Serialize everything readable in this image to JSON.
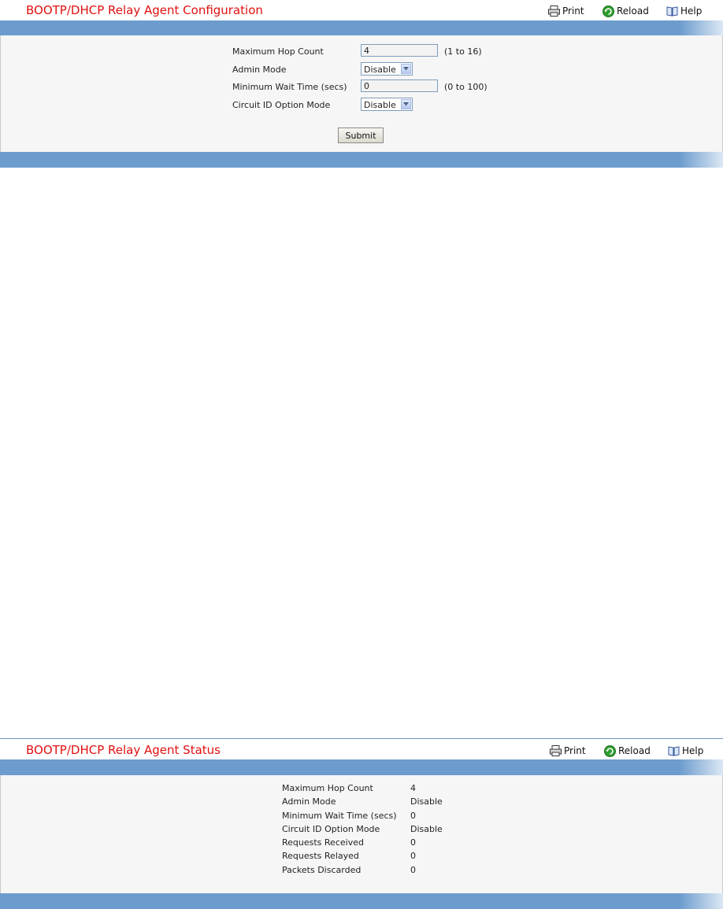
{
  "config": {
    "title": "BOOTP/DHCP Relay Agent Configuration",
    "actions": {
      "print": "Print",
      "reload": "Reload",
      "help": "Help"
    },
    "max_hop": {
      "label": "Maximum Hop Count",
      "value": "4",
      "range": "(1 to 16)"
    },
    "admin_mode": {
      "label": "Admin Mode",
      "value": "Disable"
    },
    "min_wait": {
      "label": "Minimum Wait Time (secs)",
      "value": "0",
      "range": "(0 to 100)"
    },
    "circuit_id": {
      "label": "Circuit ID Option Mode",
      "value": "Disable"
    },
    "submit_label": "Submit"
  },
  "status": {
    "title": "BOOTP/DHCP Relay Agent Status",
    "actions": {
      "print": "Print",
      "reload": "Reload",
      "help": "Help"
    },
    "rows": [
      {
        "label": "Maximum Hop Count",
        "value": "4"
      },
      {
        "label": "Admin Mode",
        "value": "Disable"
      },
      {
        "label": "Minimum Wait Time (secs)",
        "value": "0"
      },
      {
        "label": "Circuit ID Option Mode",
        "value": "Disable"
      },
      {
        "label": "Requests Received",
        "value": "0"
      },
      {
        "label": "Requests Relayed",
        "value": "0"
      },
      {
        "label": "Packets Discarded",
        "value": "0"
      }
    ]
  },
  "colors": {
    "title": "#e01010",
    "band": "#6c9ccd",
    "body": "#f6f6f6"
  }
}
